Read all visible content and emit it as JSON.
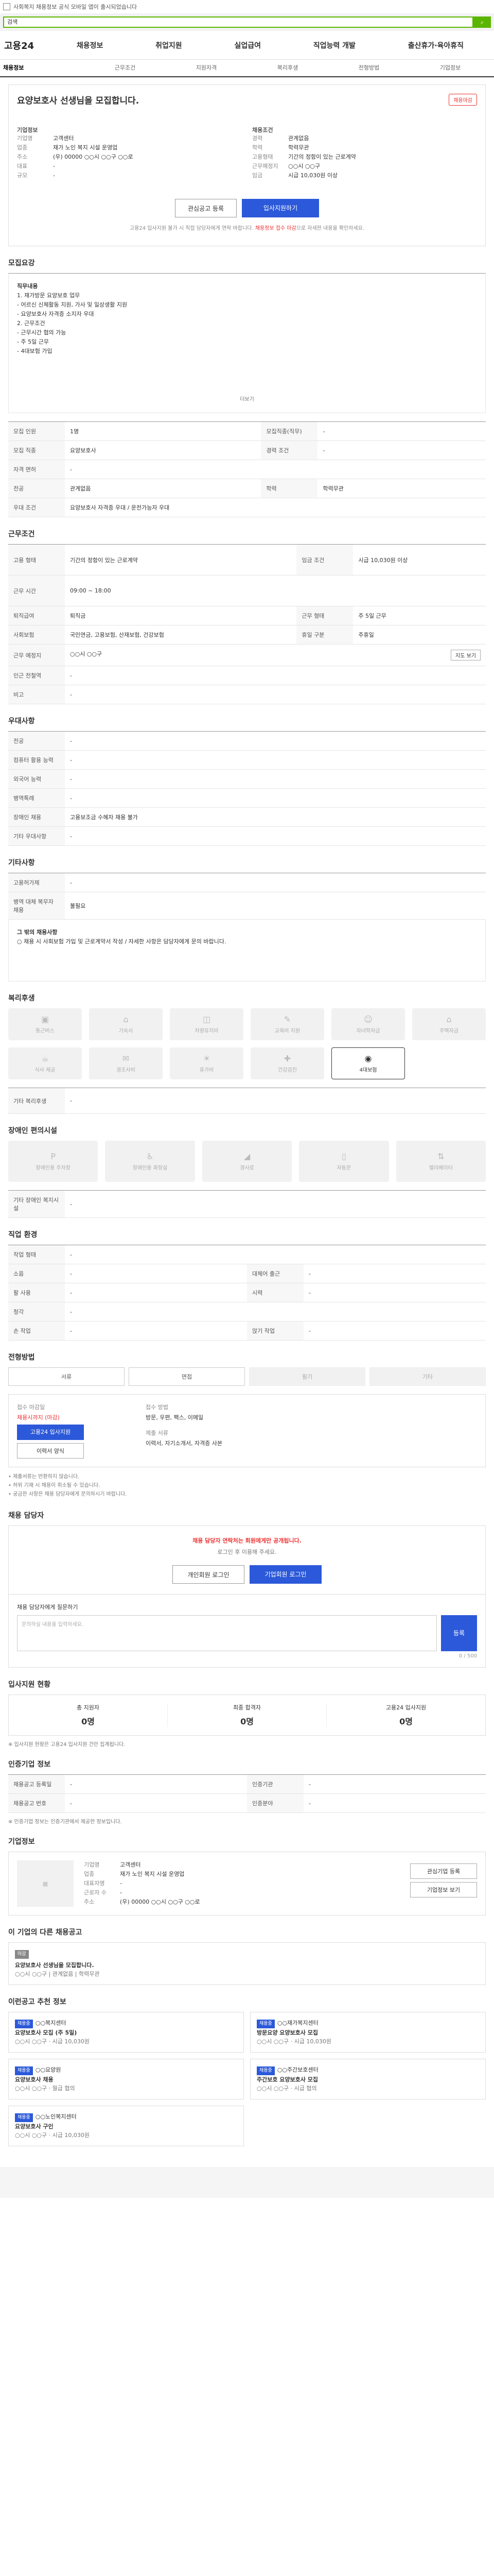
{
  "topbar": {
    "text": "사회복지 채용정보 공식 모바일 앱이 출시되었습니다"
  },
  "search": {
    "placeholder": "검색"
  },
  "logo": "고용24",
  "gnb": [
    "채용정보",
    "취업지원",
    "실업급여",
    "직업능력 개발",
    "출산휴가·육아휴직"
  ],
  "tabs": [
    "채용정보",
    "근무조건",
    "지원자격",
    "복리후생",
    "전형방법",
    "기업정보"
  ],
  "header": {
    "title": "요양보호사 선생님을 모집합니다.",
    "badge": "채용마감",
    "company_label": "기업정보",
    "company": "고객센터",
    "fields": [
      {
        "k": "업종",
        "v": "재가 노인 복지 시설 운영업"
      },
      {
        "k": "주소",
        "v": "(우) 00000 ○○시 ○○구 ○○로"
      },
      {
        "k": "대표",
        "v": "-"
      },
      {
        "k": "규모",
        "v": "-"
      }
    ],
    "right_label": "채용조건",
    "right": [
      {
        "k": "경력",
        "v": "관계없음"
      },
      {
        "k": "학력",
        "v": "학력무관"
      },
      {
        "k": "고용형태",
        "v": "기간의 정함이 있는 근로계약"
      },
      {
        "k": "근무예정지",
        "v": "○○시 ○○구"
      },
      {
        "k": "임금",
        "v": "시급 10,030원 이상"
      }
    ],
    "btn_save": "관심공고 등록",
    "btn_apply": "입사지원하기",
    "note_a": "고용24 입사지원 불가 시 직접 담당자에게 연락 바랍니다.",
    "note_b": "채용정보 접수 마감",
    "note_c": "으로 자세한 내용을 확인하세요."
  },
  "s1": {
    "title": "모집요강"
  },
  "s1_body": [
    "직무내용",
    "1. 재가방문 요양보호 업무",
    " - 어르신 신체활동 지원, 가사 및 일상생활 지원",
    " - 요양보호사 자격증 소지자 우대",
    " ",
    "2. 근무조건",
    " - 근무시간 협의 가능",
    " - 주 5일 근무",
    " - 4대보험 가입"
  ],
  "s1_fold": "더보기",
  "s1_table": [
    {
      "k": "모집 인원",
      "v": "1명",
      "k2": "모집직종(직무)",
      "v2": "-"
    },
    {
      "k": "모집 직종",
      "v": "요양보호사",
      "k2": "경력 조건",
      "v2": "-"
    },
    {
      "k": "자격 면허",
      "v": "-",
      "k2": "",
      "v2": ""
    },
    {
      "k": "전공",
      "v": "관계없음",
      "k2": "학력",
      "v2": "학력무관"
    },
    {
      "k": "우대 조건",
      "v": "요양보호사 자격증 우대 / 운전가능자 우대",
      "k2": "",
      "v2": ""
    }
  ],
  "s2": {
    "title": "근무조건"
  },
  "s2_table": [
    {
      "k": "고용 형태",
      "v": "기간의 정함이 있는 근로계약",
      "k2": "임금 조건",
      "v2": "시급 10,030원 이상"
    },
    {
      "k": "근무 시간",
      "v": "09:00 ~ 18:00",
      "k2": "",
      "v2": ""
    },
    {
      "k": "퇴직급여",
      "v": "퇴직금",
      "k2": "근무 형태",
      "v2": "주 5일 근무"
    },
    {
      "k": "사회보험",
      "v": "국민연금, 고용보험, 산재보험, 건강보험",
      "k2": "휴일 구분",
      "v2": "주휴일"
    },
    {
      "k": "근무 예정지",
      "v": "○○시 ○○구",
      "k2": "",
      "v2": ""
    },
    {
      "k": "인근 전철역",
      "v": "-",
      "k2": "",
      "v2": ""
    },
    {
      "k": "비고",
      "v": "-",
      "k2": "",
      "v2": ""
    }
  ],
  "s2_map_btn": "지도 보기",
  "s3": {
    "title": "우대사항"
  },
  "s3_table": [
    {
      "k": "전공",
      "v": "-"
    },
    {
      "k": "컴퓨터 활용 능력",
      "v": "-"
    },
    {
      "k": "외국어 능력",
      "v": "-"
    },
    {
      "k": "병역특례",
      "v": "-"
    },
    {
      "k": "장애인 채용",
      "v": "고용보조금 수혜자 채용 불가"
    },
    {
      "k": "기타 우대사항",
      "v": "-"
    }
  ],
  "s4": {
    "title": "기타사항"
  },
  "s4_table": [
    {
      "k": "고용허가제",
      "v": "-"
    },
    {
      "k": "병역 대체 복무자 채용",
      "v": "불필요"
    }
  ],
  "s4_note_title": "그 밖의 채용사항",
  "s4_note": "○ 채용 시 사회보험 가입 및 근로계약서 작성 / 자세한 사항은 담당자에게 문의 바랍니다.",
  "s5": {
    "title": "복리후생"
  },
  "s5_icons": [
    "통근버스",
    "기숙사",
    "차량유지비",
    "교육비 지원",
    "자녀학자금",
    "주택자금",
    "식사 제공",
    "경조사비",
    "휴가비",
    "건강검진",
    "4대보험"
  ],
  "s5_etc_label": "기타 복리후생",
  "s5_etc": "-",
  "s6": {
    "title": "장애인 편의시설"
  },
  "s6_icons": [
    "장애인용 주차장",
    "장애인용 화장실",
    "경사로",
    "자동문",
    "엘리베이터"
  ],
  "s6_etc_label": "기타 장애인 복지시설",
  "s6_etc": "-",
  "s7": {
    "title": "직업 환경"
  },
  "s7_table": [
    {
      "k": "작업 형태",
      "v": "-",
      "k2": "",
      "v2": ""
    },
    {
      "k": "소음",
      "v": "-",
      "k2": "대체어 출근",
      "v2": "-"
    },
    {
      "k": "팔 사용",
      "v": "-",
      "k2": "시력",
      "v2": "-"
    },
    {
      "k": "청각",
      "v": "-",
      "k2": "",
      "v2": ""
    },
    {
      "k": "손 작업",
      "v": "-",
      "k2": "앉기 작업",
      "v2": "-"
    }
  ],
  "s8": {
    "title": "전형방법"
  },
  "s8_flow": [
    "서류",
    "면접",
    "필기",
    "기타"
  ],
  "s8_apply_label": "접수 마감일",
  "s8_apply": "채용시까지 (마감)",
  "s8_method_label": "접수 방법",
  "s8_method": "방문, 우편, 팩스, 이메일",
  "s8_docs_label": "제출 서류",
  "s8_docs": "이력서, 자기소개서, 자격증 사본",
  "s8_btn1": "고용24 입사지원",
  "s8_btn2": "이력서 양식",
  "s8_notes": [
    "• 제출서류는 반환하지 않습니다.",
    "• 허위 기재 시 채용이 취소될 수 있습니다.",
    "• 궁금한 사항은 채용 담당자에게 문의하시기 바랍니다."
  ],
  "s9": {
    "title": "채용 담당자"
  },
  "s9_warn": "채용 담당자 연락처는 회원에게만 공개됩니다.",
  "s9_sub": "로그인 후 이용해 주세요.",
  "s9_btn1": "개인회원 로그인",
  "s9_btn2": "기업회원 로그인",
  "s9_q_label": "채용 담당자에게 질문하기",
  "s9_q_placeholder": "문의하실 내용을 입력하세요.",
  "s9_q_btn": "등록",
  "s9_counter": "0 / 500",
  "s10": {
    "title": "입사지원 현황"
  },
  "s10_stats": [
    {
      "k": "총 지원자",
      "v": "0명"
    },
    {
      "k": "최종 합격자",
      "v": "0명"
    },
    {
      "k": "고용24 입사지원",
      "v": "0명"
    }
  ],
  "s10_note": "※ 입사지원 현황은 고용24 입사지원 건만 집계됩니다.",
  "s11": {
    "title": "인증기업 정보"
  },
  "s11_table": [
    {
      "k": "채용공고 등록일",
      "v": "-",
      "k2": "인증기관",
      "v2": "-"
    },
    {
      "k": "채용공고 번호",
      "v": "-",
      "k2": "인증분야",
      "v2": "-"
    }
  ],
  "s11_note": "※ 인증기업 정보는 인증기관에서 제공한 정보입니다.",
  "s12": {
    "title": "기업정보"
  },
  "s12_rows": [
    {
      "k": "기업명",
      "v": "고객센터"
    },
    {
      "k": "업종",
      "v": "재가 노인 복지 시설 운영업"
    },
    {
      "k": "대표자명",
      "v": "-"
    },
    {
      "k": "근로자 수",
      "v": "-"
    },
    {
      "k": "주소",
      "v": "(우) 00000 ○○시 ○○구 ○○로"
    }
  ],
  "s12_btn1": "관심기업 등록",
  "s12_btn2": "기업정보 보기",
  "s13": {
    "title": "이 기업의 다른 채용공고"
  },
  "s13_card_tag": "마감",
  "s13_card_title": "요양보호사 선생님을 모집합니다.",
  "s13_card_meta": "○○시 ○○구 | 관계없음 | 학력무관",
  "s14": {
    "title": "이런공고 추천 정보"
  },
  "s14_cards": [
    {
      "tag": "채용중",
      "co": "○○복지센터",
      "title": "요양보호사 모집 (주 5일)",
      "meta": "○○시 ○○구 · 시급 10,030원"
    },
    {
      "tag": "채용중",
      "co": "○○재가복지센터",
      "title": "방문요양 요양보호사 모집",
      "meta": "○○시 ○○구 · 시급 10,030원"
    },
    {
      "tag": "채용중",
      "co": "○○요양원",
      "title": "요양보호사 채용",
      "meta": "○○시 ○○구 · 월급 협의"
    },
    {
      "tag": "채용중",
      "co": "○○주간보호센터",
      "title": "주간보호 요양보호사 모집",
      "meta": "○○시 ○○구 · 시급 협의"
    },
    {
      "tag": "채용중",
      "co": "○○노인복지센터",
      "title": "요양보호사 구인",
      "meta": "○○시 ○○구 · 시급 10,030원"
    }
  ]
}
